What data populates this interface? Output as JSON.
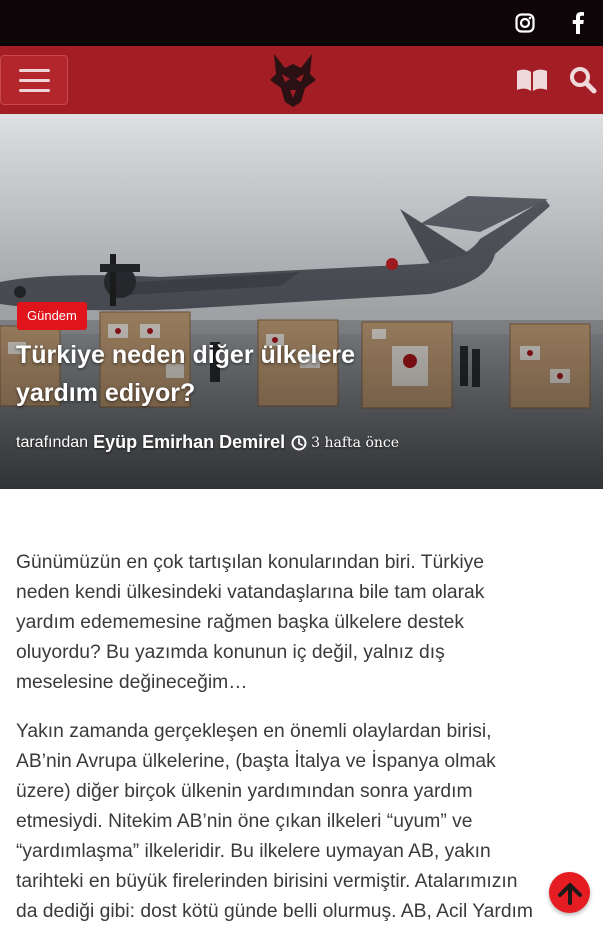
{
  "topbar": {
    "social": [
      {
        "name": "instagram-icon"
      },
      {
        "name": "facebook-icon"
      }
    ],
    "icon_color": "#ffffff",
    "background": "#0d0507"
  },
  "header": {
    "background": "#a31e24",
    "icons": {
      "menu": "hamburger-icon",
      "book": "book-icon",
      "search": "search-icon",
      "logo": "wolf-logo"
    }
  },
  "hero": {
    "category": "Gündem",
    "category_color": "#e1141c",
    "title": "Türkiye neden diğer ülkelere yardım ediyor?",
    "byline_prefix": "tarafından",
    "author": "Eyüp Emirhan Demirel",
    "time_ago": "3 hafta önce"
  },
  "article": {
    "paragraphs": [
      {
        "lines": [
          "Günümüzün en çok tartışılan konularından biri. Türkiye",
          "neden kendi ülkesindeki vatandaşlarına bile tam olarak",
          "yardım edememesine rağmen başka ülkelere destek",
          "oluyordu? Bu yazımda konunun iç değil, yalnız dış",
          "meselesine değineceğim…"
        ]
      },
      {
        "lines": [
          "Yakın zamanda gerçekleşen en önemli olaylardan birisi,",
          "AB’nin Avrupa ülkelerine, (başta İtalya ve İspanya olmak",
          "üzere) diğer birçok ülkenin yardımından sonra yardım",
          "etmesiydi. Nitekim AB’nin öne çıkan ilkeleri “uyum” ve",
          "“yardımlaşma” ilkeleridir. Bu ilkelere uymayan AB, yakın",
          "tarihteki en büyük firelerinden birisini vermiştir. Atalarımızın",
          "da dediği gibi: dost kötü günde belli olurmuş. AB, Acil Yardım"
        ]
      }
    ]
  },
  "scroll_top": {
    "icon": "arrow-up-icon",
    "color": "#e51d23"
  }
}
